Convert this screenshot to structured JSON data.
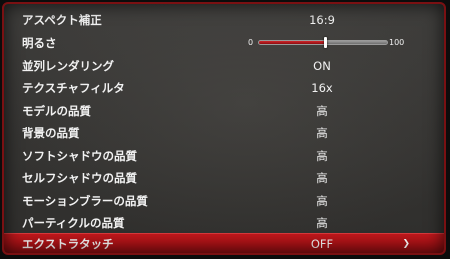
{
  "settings": [
    {
      "label": "アスペクト補正",
      "value": "16:9"
    },
    {
      "label": "明るさ",
      "type": "slider",
      "min_label": "0",
      "max_label": "100",
      "level": 0.52
    },
    {
      "label": "並列レンダリング",
      "value": "ON"
    },
    {
      "label": "テクスチャフィルタ",
      "value": "16x"
    },
    {
      "label": "モデルの品質",
      "value": "高"
    },
    {
      "label": "背景の品質",
      "value": "高"
    },
    {
      "label": "ソフトシャドウの品質",
      "value": "高"
    },
    {
      "label": "セルフシャドウの品質",
      "value": "高"
    },
    {
      "label": "モーションブラーの品質",
      "value": "高"
    },
    {
      "label": "パーティクルの品質",
      "value": "高"
    },
    {
      "label": "エクストラタッチ",
      "value": "OFF",
      "selected": true,
      "arrow_icon": "chevron-right-icon",
      "arrow_glyph": "❯"
    }
  ],
  "colors": {
    "selected_bg": "#b0141a",
    "frame_border": "#7a1012",
    "slider_fill": "#c0181c"
  }
}
